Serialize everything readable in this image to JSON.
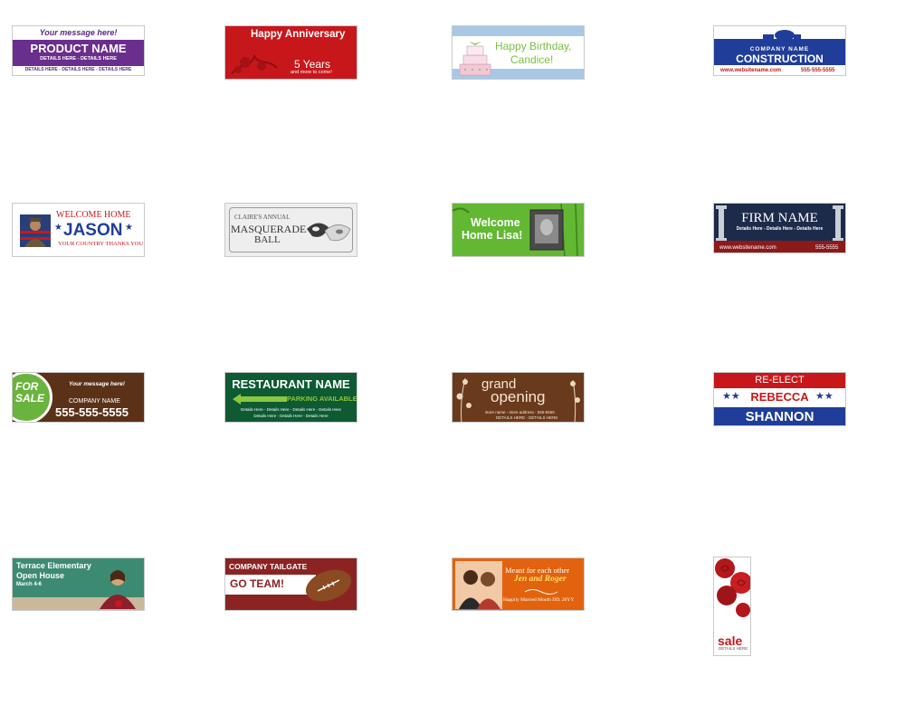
{
  "banners": {
    "product": {
      "message": "Your message here!",
      "name": "PRODUCT NAME",
      "details1": "DETAILS HERE - DETAILS HERE",
      "details2": "DETAILS HERE - DETAILS HERE - DETAILS HERE"
    },
    "anniversary": {
      "title": "Happy Anniversary",
      "years": "5 Years",
      "sub": "and more to come!"
    },
    "birthday": {
      "line1": "Happy Birthday,",
      "line2": "Candice!"
    },
    "construction": {
      "company": "COMPANY NAME",
      "name": "CONSTRUCTION",
      "website": "www.websitename.com",
      "phone": "555-555-5555"
    },
    "welcome_jason": {
      "line1": "WELCOME HOME",
      "name": "JASON",
      "line2": "YOUR COUNTRY THANKS YOU"
    },
    "masquerade": {
      "line1": "CLAIRE'S ANNUAL",
      "line2": "MASQUERADE",
      "line3": "BALL"
    },
    "lisa": {
      "line1": "Welcome",
      "line2": "Home Lisa!"
    },
    "firm": {
      "name": "FIRM NAME",
      "details": "Details Here - Details Here - Details Here",
      "website": "www.websitename.com",
      "phone": "555-5555"
    },
    "forsale": {
      "for": "FOR",
      "sale": "SALE",
      "message": "Your message here!",
      "company": "COMPANY NAME",
      "phone": "555-555-5555"
    },
    "restaurant": {
      "name": "RESTAURANT NAME",
      "parking": "PARKING AVAILABLE",
      "details1": "Details Here - Details Here - Details Here - Details Here",
      "details2": "Details Here - Details Here - Details Here"
    },
    "grand": {
      "line1": "grand",
      "line2": "opening",
      "info": "store name - store address - 555-5555",
      "details": "DETAILS HERE - DETAILS HERE"
    },
    "reelect": {
      "top": "RE-ELECT",
      "first": "REBECCA",
      "last": "SHANNON"
    },
    "terrace": {
      "line1": "Terrace Elementary",
      "line2": "Open House",
      "dates": "March 4-6"
    },
    "tailgate": {
      "line1": "COMPANY TAILGATE",
      "line2": "GO TEAM!"
    },
    "meant": {
      "line1": "Meant for each other",
      "names": "Jen and Roger",
      "line2": "Happily Married Month DD, 20YY"
    },
    "sale": {
      "word": "sale",
      "details": "DETAILS HERE"
    }
  }
}
